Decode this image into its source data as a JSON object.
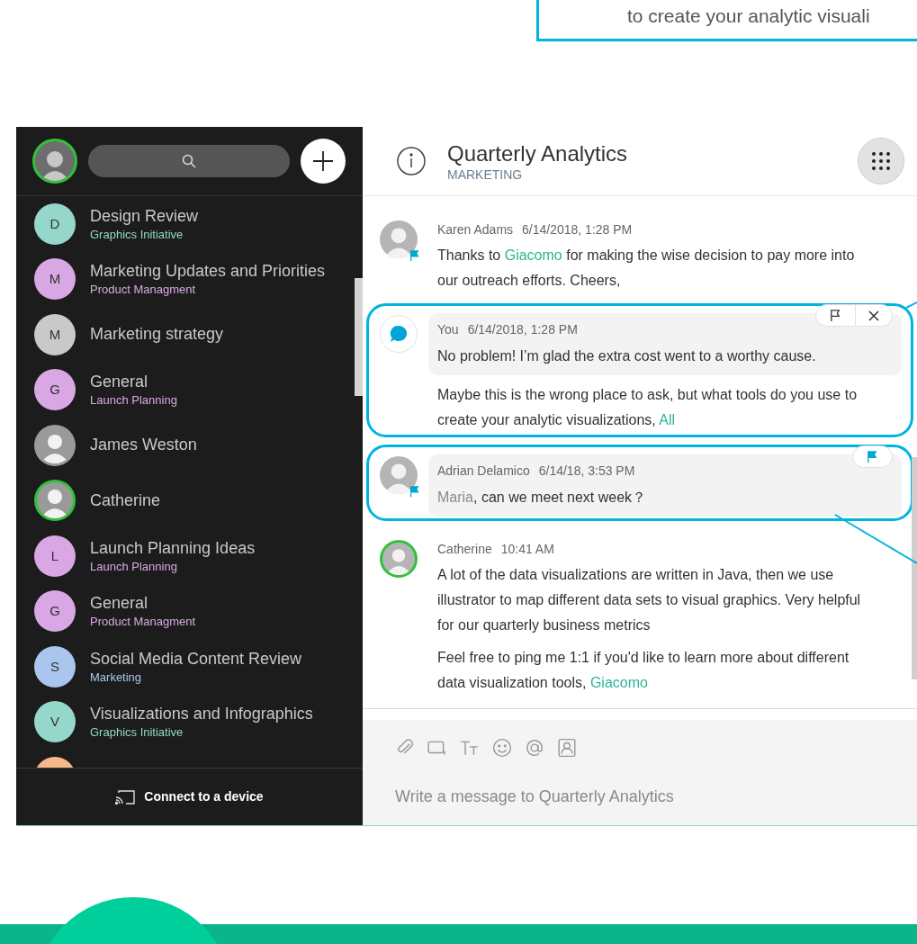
{
  "callout": {
    "text": "to create your analytic visuali"
  },
  "sidebar": {
    "items": [
      {
        "kind": "initial",
        "initial": "D",
        "title": "Design Review",
        "subtitle": "Graphics Initiative",
        "color": "#95d7cb",
        "online": false
      },
      {
        "kind": "initial",
        "initial": "M",
        "title": "Marketing Updates and Priorities",
        "subtitle": "Product Managment",
        "color": "#d9a8e4",
        "online": false
      },
      {
        "kind": "initial",
        "initial": "M",
        "title": "Marketing strategy",
        "color": "#c9c9c9",
        "online": false
      },
      {
        "kind": "initial",
        "initial": "G",
        "title": "General",
        "subtitle": "Launch Planning",
        "color": "#d9a8e4",
        "online": false
      },
      {
        "kind": "photo",
        "title": "James Weston",
        "online": false
      },
      {
        "kind": "photo",
        "title": "Catherine",
        "online": true
      },
      {
        "kind": "initial",
        "initial": "L",
        "title": "Launch Planning Ideas",
        "subtitle": "Launch Planning",
        "color": "#d9a8e4",
        "online": false
      },
      {
        "kind": "initial",
        "initial": "G",
        "title": "General",
        "subtitle": "Product Managment",
        "color": "#d9a8e4",
        "online": false
      },
      {
        "kind": "initial",
        "initial": "S",
        "title": "Social Media Content Review",
        "subtitle": "Marketing",
        "color": "#aac6ef",
        "online": false
      },
      {
        "kind": "initial",
        "initial": "V",
        "title": "Visualizations and Infographics",
        "subtitle": "Graphics Initiative",
        "color": "#95d7cb",
        "online": false
      },
      {
        "kind": "initial",
        "color": "#f7b98a"
      }
    ],
    "connect": "Connect to a device"
  },
  "header": {
    "title": "Quarterly Analytics",
    "subtitle": "MARKETING"
  },
  "messages": [
    {
      "kind": "photo",
      "online": false,
      "author": "Karen Adams",
      "time": "6/14/2018, 1:28 PM",
      "flagged": true,
      "highlighted": false,
      "bubble": false,
      "paragraphs": [
        [
          {
            "kind": "text",
            "text": "Thanks to "
          },
          {
            "kind": "mention",
            "text": "Giacomo"
          },
          {
            "kind": "text",
            "text": " for making the wise decision to pay more into our outreach efforts. Cheers,"
          }
        ]
      ]
    },
    {
      "kind": "self",
      "author": "You",
      "time": "6/14/2018, 1:28 PM",
      "flagged": false,
      "highlighted": true,
      "bubble": true,
      "actions": [
        {
          "kind": "flag"
        },
        {
          "kind": "close"
        }
      ],
      "paragraphs": [
        [
          {
            "kind": "text",
            "text": "No problem! I’m glad the extra cost went to a worthy cause."
          }
        ],
        [
          {
            "kind": "text",
            "text": "Maybe this is the wrong place to ask, but what tools do you use to create your analytic visualizations, "
          },
          {
            "kind": "mention",
            "text": "All"
          }
        ]
      ]
    },
    {
      "kind": "photo",
      "online": false,
      "author": "Adrian Delamico",
      "time": "6/14/18, 3:53 PM",
      "flagged": true,
      "highlighted": true,
      "bubble": true,
      "actions": [
        {
          "kind": "flag"
        }
      ],
      "paragraphs": [
        [
          {
            "kind": "self_mention",
            "text": "Maria"
          },
          {
            "kind": "text",
            "text": ", can we meet next week？"
          }
        ]
      ]
    },
    {
      "kind": "photo",
      "online": true,
      "author": "Catherine",
      "time": "10:41 AM",
      "flagged": false,
      "highlighted": false,
      "bubble": false,
      "paragraphs": [
        [
          {
            "kind": "text",
            "text": "A lot of the data visualizations are written in Java, then we use illustrator to map different data sets to visual graphics. Very helpful for our quarterly business metrics"
          }
        ],
        [
          {
            "kind": "text",
            "text": "Feel free to ping me 1:1 if you'd like to learn more about different data visualization tools, "
          },
          {
            "kind": "mention",
            "text": "Giacomo"
          }
        ]
      ]
    }
  ],
  "composer": {
    "tools": [
      {
        "kind": "attach"
      },
      {
        "kind": "screen"
      },
      {
        "kind": "text"
      },
      {
        "kind": "emoji"
      },
      {
        "kind": "mention"
      },
      {
        "kind": "contact"
      }
    ],
    "placeholder": "Write a message to Quarterly Analytics"
  }
}
